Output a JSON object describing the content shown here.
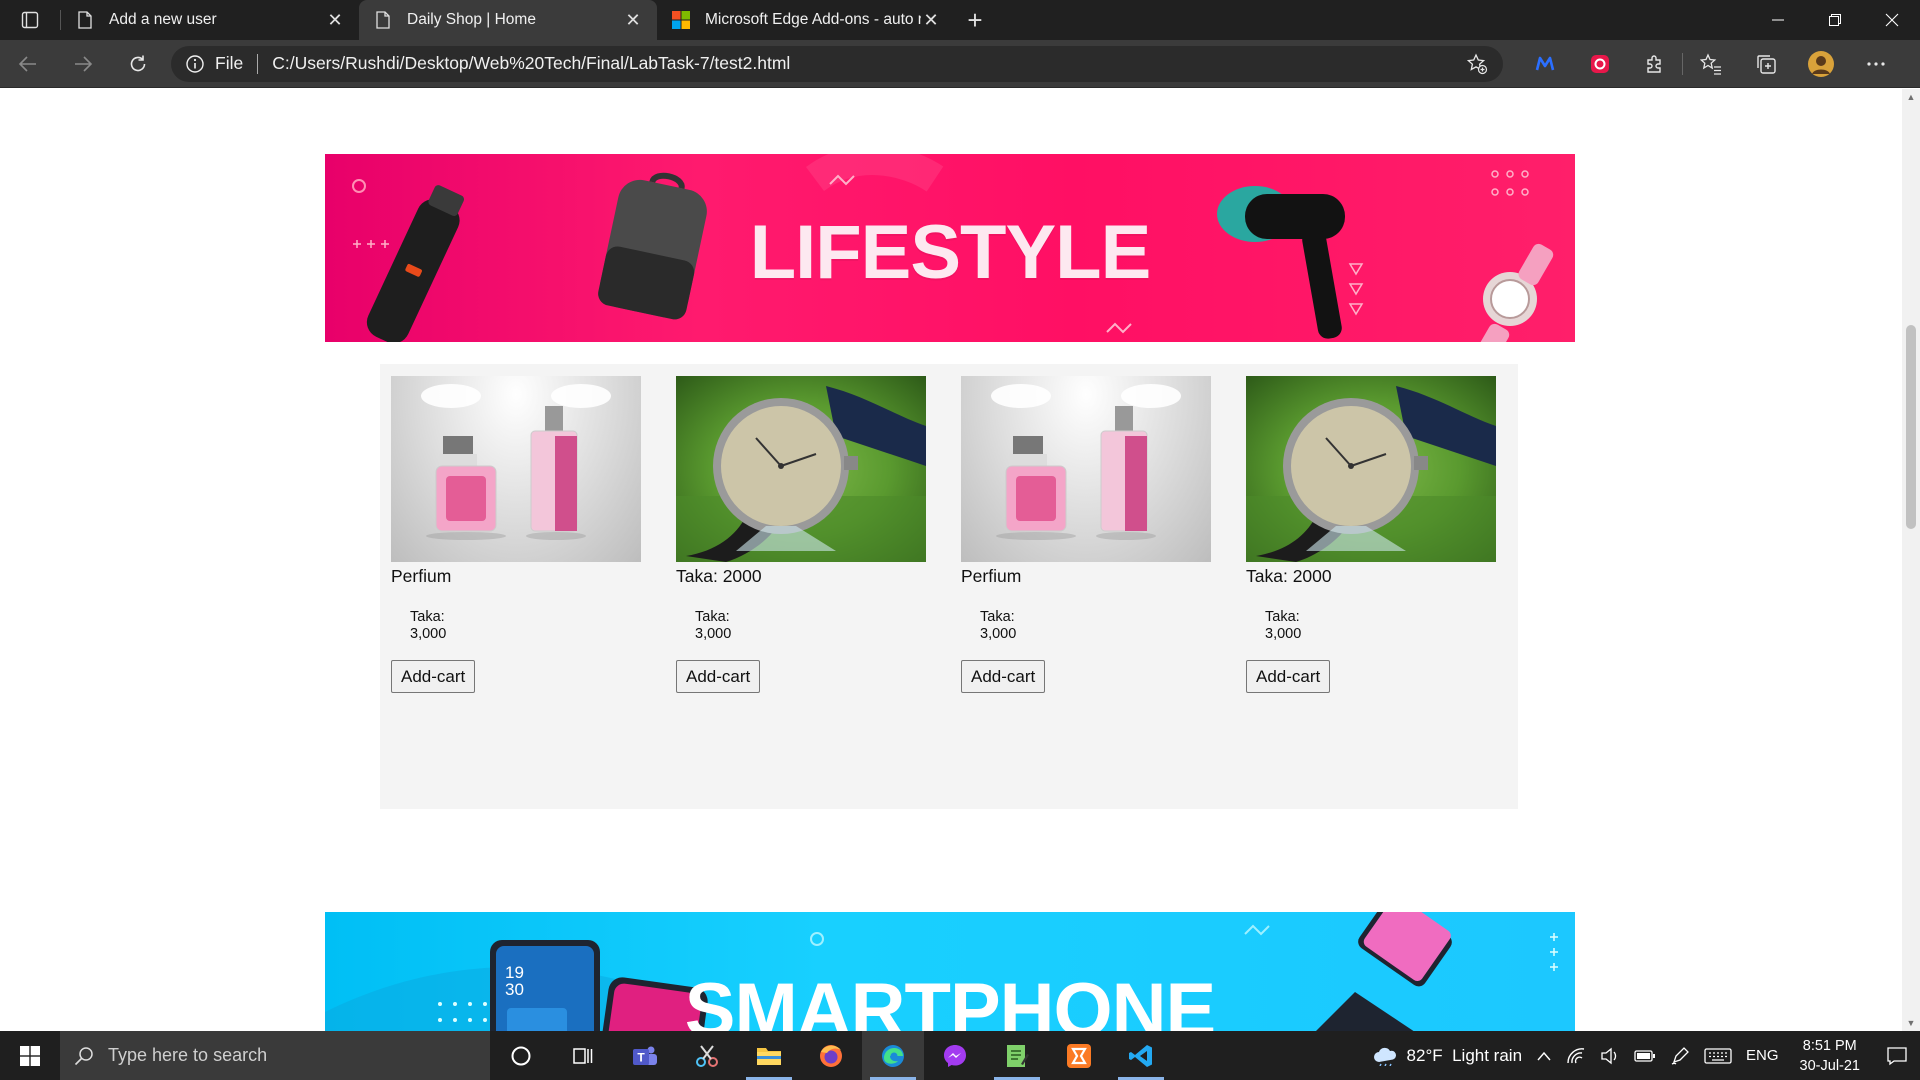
{
  "browser": {
    "tabs": [
      {
        "title": "Add a new user",
        "active": false
      },
      {
        "title": "Daily Shop | Home",
        "active": true
      },
      {
        "title": "Microsoft Edge Add-ons - auto r",
        "active": false
      }
    ],
    "address": {
      "scheme_label": "File",
      "url": "C:/Users/Rushdi/Desktop/Web%20Tech/Final/LabTask-7/test2.html"
    }
  },
  "page": {
    "banner_top": {
      "title": "LIFESTYLE"
    },
    "products": [
      {
        "name": "Perfium",
        "price_label": "Taka:",
        "price": "3,000",
        "button": "Add-cart",
        "image": "perfume"
      },
      {
        "name": "Taka: 2000",
        "price_label": "Taka:",
        "price": "3,000",
        "button": "Add-cart",
        "image": "watch"
      },
      {
        "name": "Perfium",
        "price_label": "Taka:",
        "price": "3,000",
        "button": "Add-cart",
        "image": "perfume"
      },
      {
        "name": "Taka: 2000",
        "price_label": "Taka:",
        "price": "3,000",
        "button": "Add-cart",
        "image": "watch"
      }
    ],
    "banner_bottom": {
      "title": "SMARTPHONE",
      "phone_date": "19\n30"
    }
  },
  "taskbar": {
    "search_placeholder": "Type here to search",
    "weather": "82°F  Light rain",
    "language": "ENG",
    "time": "8:51 PM",
    "date": "30-Jul-21"
  },
  "colors": {
    "lifestyle_banner": "#ff1a6e",
    "smartphone_banner": "#18d0ff",
    "browser_chrome": "#202020"
  }
}
